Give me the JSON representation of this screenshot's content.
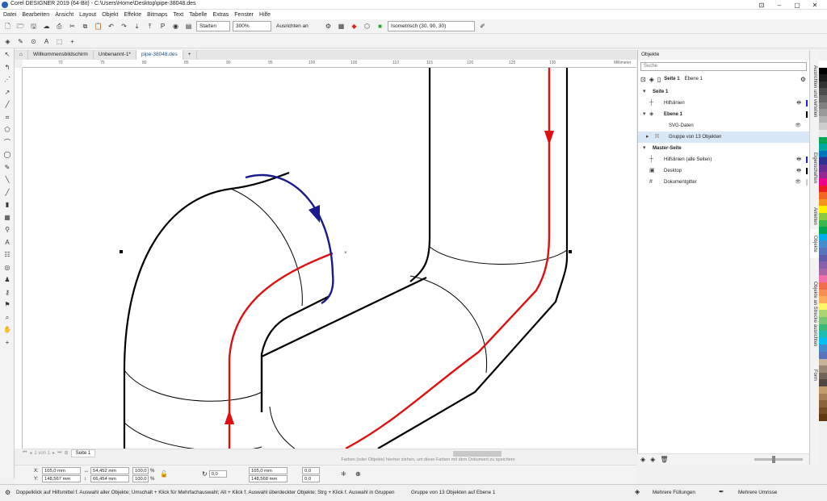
{
  "title": "Corel DESIGNER 2019 (64-Bit) - C:\\Users\\Home\\Desktop\\pipe-38048.des",
  "menu": [
    "Datei",
    "Bearbeiten",
    "Ansicht",
    "Layout",
    "Objekt",
    "Effekte",
    "Bitmaps",
    "Text",
    "Tabelle",
    "Extras",
    "Fenster",
    "Hilfe"
  ],
  "toolbar": {
    "launch": "Starten",
    "zoom": "300%",
    "align": "Ausrichten an",
    "projection": "Isometrisch (30, 90, 30)"
  },
  "tabs": [
    "Willkommensbildschirm",
    "Unbenannt-1*",
    "pipe-38048.des"
  ],
  "ruler": {
    "h": [
      "70",
      "75",
      "80",
      "85",
      "90",
      "95",
      "100",
      "105",
      "110",
      "115",
      "120",
      "125",
      "130"
    ],
    "unit": "Millimeter"
  },
  "pagenav": {
    "of": "1 von 1",
    "page": "Seite 1"
  },
  "hint": "Farben (oder Objekte) hierher ziehen, um diese Farben mit dem Dokument zu speichern",
  "props": {
    "x": "105,0 mm",
    "y": "148,567 mm",
    "w": "54,452 mm",
    "h": "66,454 mm",
    "sx": "100,0",
    "sy": "100,0",
    "pct": "%",
    "rot": "0,0",
    "px": "105,0 mm",
    "py": "148,568 mm",
    "o1": "0,0",
    "o2": "0,0"
  },
  "panel": {
    "title": "Objekte",
    "search": "Suche",
    "page": "Seite 1",
    "layer": "Ebene 1"
  },
  "objects": [
    {
      "label": "Seite 1",
      "bold": true,
      "color": ""
    },
    {
      "label": "Hilfslinien",
      "color": "#2222cc"
    },
    {
      "label": "Ebene 1",
      "bold": true,
      "color": "#000000"
    },
    {
      "label": "SVG-Daten",
      "color": ""
    },
    {
      "label": "Gruppe von 13 Objekten",
      "color": "",
      "selected": true
    },
    {
      "label": "Master-Seite",
      "bold": true,
      "color": ""
    },
    {
      "label": "Hilfslinien (alle Seiten)",
      "color": "#2222cc"
    },
    {
      "label": "Desktop",
      "color": "#000000"
    },
    {
      "label": "Dokumentgitter",
      "color": "#cccccc"
    }
  ],
  "vtabs": [
    "Ausrichten und verteilen",
    "Eigenschaften",
    "Anleiten",
    "Objekte",
    "Objekte an Strecke ausrichten",
    "Form"
  ],
  "status": {
    "hint": "Doppelklick auf Hilfsmittel f. Auswahl aller Objekte; Umschalt + Klick für Mehrfachauswahl; Alt + Klick f. Auswahl überdeckter Objekte; Strg + Klick f. Auswahl in Gruppen",
    "selection": "Gruppe von 13 Objekten auf Ebene 1",
    "fill": "Mehrere Füllungen",
    "outline": "Mehrere Umrisse"
  },
  "palette": [
    "#ffffff",
    "#000000",
    "#1a1a1a",
    "#333333",
    "#4d4d4d",
    "#666666",
    "#808080",
    "#999999",
    "#b3b3b3",
    "#cccccc",
    "#e6e6e6",
    "#00a651",
    "#00a99d",
    "#0072bc",
    "#2e3192",
    "#662d91",
    "#92278f",
    "#ec008c",
    "#ed1c24",
    "#f26522",
    "#f7941d",
    "#fff200",
    "#8dc63f",
    "#39b54a",
    "#00a650",
    "#00aeef",
    "#448ccb",
    "#5674b9",
    "#605ca8",
    "#8560a8",
    "#a864a8",
    "#f06eaa",
    "#f26c4f",
    "#f68e56",
    "#fbaf5d",
    "#fff568",
    "#acd373",
    "#7cc576",
    "#3cb878",
    "#1cbbb4",
    "#00bff3",
    "#438cca",
    "#5574b9",
    "#c7b299",
    "#998675",
    "#736357",
    "#534741",
    "#c69c6d",
    "#a67c52",
    "#8c6239",
    "#754c24",
    "#603913"
  ]
}
